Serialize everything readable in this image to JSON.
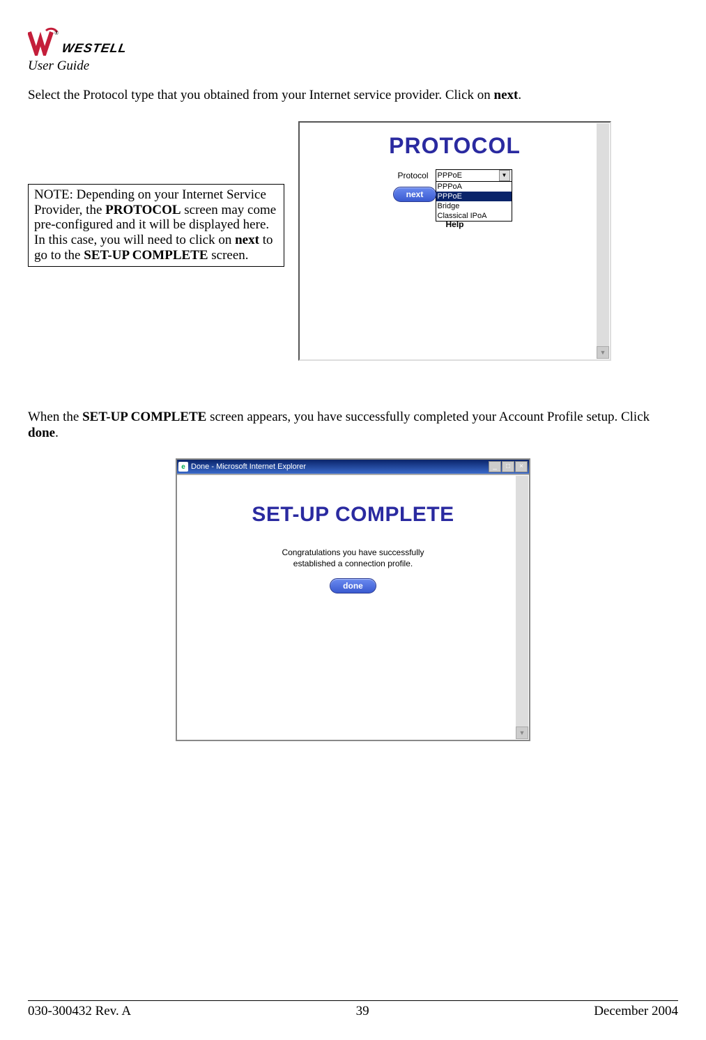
{
  "header": {
    "brand": "WESTELL",
    "subtitle": "User Guide"
  },
  "para1": {
    "pre": "Select the Protocol type that you obtained from your Internet service provider. Click on ",
    "bold": "next",
    "post": "."
  },
  "note": {
    "pre": "NOTE: Depending on your Internet Service Provider, the ",
    "b1": "PROTOCOL",
    "mid1": " screen may come pre-configured and it will be displayed here. In this case, you will need to click on ",
    "b2": "next",
    "mid2": " to go to the ",
    "b3": "SET-UP COMPLETE",
    "post": " screen."
  },
  "protocol_panel": {
    "title": "PROTOCOL",
    "label": "Protocol",
    "selected": "PPPoE",
    "options": [
      "PPPoA",
      "PPPoE",
      "Bridge",
      "Classical IPoA"
    ],
    "next_btn": "next",
    "help": "Help"
  },
  "para2": {
    "pre": "When the ",
    "b1": "SET-UP COMPLETE",
    "mid": " screen appears, you have successfully completed your Account Profile setup. Click ",
    "b2": "done",
    "post": "."
  },
  "ie_window": {
    "title": "Done - Microsoft Internet Explorer",
    "body_title": "SET-UP COMPLETE",
    "congrats_l1": "Congratulations you have successfully",
    "congrats_l2": "established a connection profile.",
    "done_btn": "done"
  },
  "footer": {
    "left": "030-300432 Rev. A",
    "center": "39",
    "right": "December 2004"
  }
}
